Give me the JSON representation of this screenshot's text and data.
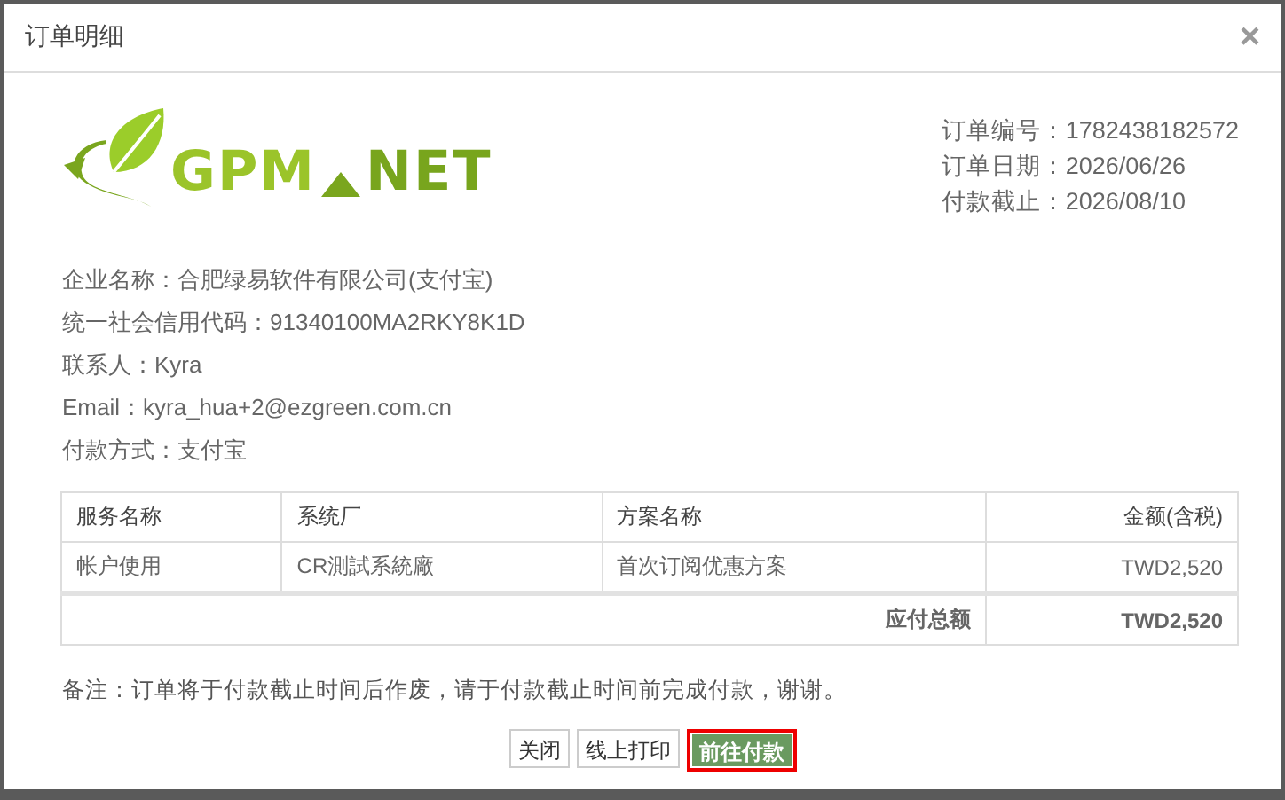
{
  "dialog": {
    "title": "订单明细",
    "close": "×"
  },
  "logo": {
    "left": "GPM",
    "right": "NET"
  },
  "order_info": [
    {
      "label": "订单编号：",
      "value": "1782438182572"
    },
    {
      "label": "订单日期：",
      "value": "2026/06/26"
    },
    {
      "label": "付款截止：",
      "value": "2026/08/10"
    }
  ],
  "customer_info": [
    {
      "label": "企业名称：",
      "value": "合肥绿易软件有限公司(支付宝)"
    },
    {
      "label": "统一社会信用代码：",
      "value": "91340100MA2RKY8K1D"
    },
    {
      "label": "联系人：",
      "value": "Kyra"
    },
    {
      "label": "Email：",
      "value": "kyra_hua+2@ezgreen.com.cn"
    },
    {
      "label": "付款方式：",
      "value": "支付宝"
    }
  ],
  "table": {
    "columns": [
      "服务名称",
      "系统厂",
      "方案名称",
      "金额(含税)"
    ],
    "rows": [
      [
        "帐户使用",
        "CR測試系統廠",
        "首次订阅优惠方案",
        "TWD2,520"
      ]
    ],
    "total_label": "应付总额",
    "total_value": "TWD2,520"
  },
  "note": "备注：订单将于付款截止时间后作废，请于付款截止时间前完成付款，谢谢。",
  "buttons": [
    {
      "label": "关闭",
      "kind": "default",
      "focused": false
    },
    {
      "label": "线上打印",
      "kind": "default",
      "focused": false
    },
    {
      "label": "前往付款",
      "kind": "primary",
      "focused": true
    }
  ]
}
